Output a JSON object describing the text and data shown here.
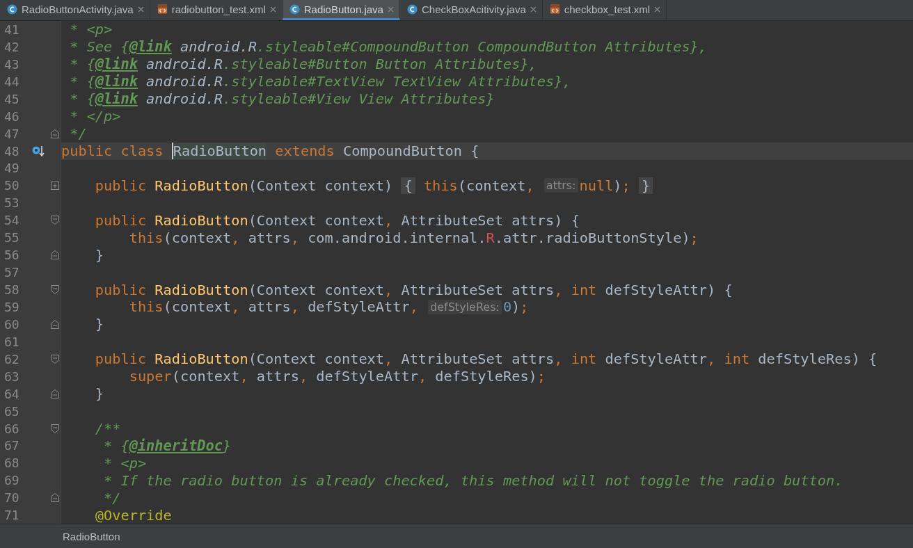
{
  "tabs": [
    {
      "label": "RadioButtonActivity.java",
      "kind": "java",
      "selected": false
    },
    {
      "label": "radiobutton_test.xml",
      "kind": "xml",
      "selected": false
    },
    {
      "label": "RadioButton.java",
      "kind": "java",
      "selected": true
    },
    {
      "label": "CheckBoxAcitivity.java",
      "kind": "java",
      "selected": false
    },
    {
      "label": "checkbox_test.xml",
      "kind": "xml",
      "selected": false
    }
  ],
  "lines": [
    {
      "number": "41",
      "tokens": [
        {
          "kind": "comment",
          "t": " * <p>"
        }
      ]
    },
    {
      "number": "42",
      "tokens": [
        {
          "kind": "comment",
          "t": " * See {"
        },
        {
          "kind": "doctag",
          "t": "@link"
        },
        {
          "kind": "docref",
          "t": " android.R"
        },
        {
          "kind": "comment",
          "t": ".styleable#CompoundButton CompoundButton Attributes},"
        }
      ]
    },
    {
      "number": "43",
      "tokens": [
        {
          "kind": "comment",
          "t": " * {"
        },
        {
          "kind": "doctag",
          "t": "@link"
        },
        {
          "kind": "docref",
          "t": " android.R"
        },
        {
          "kind": "comment",
          "t": ".styleable#Button Button Attributes},"
        }
      ]
    },
    {
      "number": "44",
      "tokens": [
        {
          "kind": "comment",
          "t": " * {"
        },
        {
          "kind": "doctag",
          "t": "@link"
        },
        {
          "kind": "docref",
          "t": " android.R"
        },
        {
          "kind": "comment",
          "t": ".styleable#TextView TextView Attributes},"
        }
      ]
    },
    {
      "number": "45",
      "tokens": [
        {
          "kind": "comment",
          "t": " * {"
        },
        {
          "kind": "doctag",
          "t": "@link"
        },
        {
          "kind": "docref",
          "t": " android.R"
        },
        {
          "kind": "comment",
          "t": ".styleable#View View Attributes}"
        }
      ]
    },
    {
      "number": "46",
      "tokens": [
        {
          "kind": "comment",
          "t": " * </p>"
        }
      ]
    },
    {
      "number": "47",
      "fold": {
        "kind": "end"
      },
      "tokens": [
        {
          "kind": "comment",
          "t": " */"
        }
      ]
    },
    {
      "number": "48",
      "current": true,
      "gutter_icon": true,
      "tokens": [
        {
          "kind": "kw",
          "t": "public class "
        },
        {
          "kind": "usage",
          "t": "RadioButton"
        },
        {
          "kind": "kw",
          "t": " extends "
        },
        {
          "kind": "plain",
          "t": "CompoundButton {"
        }
      ]
    },
    {
      "number": "49"
    },
    {
      "number": "50",
      "fold": {
        "kind": "collapsed"
      },
      "tokens": [
        {
          "kind": "kw",
          "t": "    public "
        },
        {
          "kind": "fn",
          "t": "RadioButton"
        },
        {
          "kind": "plain",
          "t": "(Context context) "
        },
        {
          "kind": "folded",
          "t": "{"
        },
        {
          "kind": "kw",
          "t": " this"
        },
        {
          "kind": "plain",
          "t": "(context"
        },
        {
          "kind": "kw",
          "t": ", "
        },
        {
          "kind": "hint",
          "t": "attrs:"
        },
        {
          "kind": "kw",
          "t": "null"
        },
        {
          "kind": "plain",
          "t": ")"
        },
        {
          "kind": "kw",
          "t": "; "
        },
        {
          "kind": "folded",
          "t": "}"
        }
      ]
    },
    {
      "number": "53"
    },
    {
      "number": "54",
      "fold": {
        "kind": "start"
      },
      "tokens": [
        {
          "kind": "kw",
          "t": "    public "
        },
        {
          "kind": "fn",
          "t": "RadioButton"
        },
        {
          "kind": "plain",
          "t": "(Context context"
        },
        {
          "kind": "kw",
          "t": ", "
        },
        {
          "kind": "plain",
          "t": "AttributeSet attrs) {"
        }
      ]
    },
    {
      "number": "55",
      "tokens": [
        {
          "kind": "kw",
          "t": "        this"
        },
        {
          "kind": "plain",
          "t": "(context"
        },
        {
          "kind": "kw",
          "t": ", "
        },
        {
          "kind": "plain",
          "t": "attrs"
        },
        {
          "kind": "kw",
          "t": ", "
        },
        {
          "kind": "plain",
          "t": "com.android.internal."
        },
        {
          "kind": "rclass",
          "t": "R"
        },
        {
          "kind": "plain",
          "t": ".attr.radioButtonStyle)"
        },
        {
          "kind": "kw",
          "t": ";"
        }
      ]
    },
    {
      "number": "56",
      "fold": {
        "kind": "end"
      },
      "tokens": [
        {
          "kind": "plain",
          "t": "    }"
        }
      ]
    },
    {
      "number": "57"
    },
    {
      "number": "58",
      "fold": {
        "kind": "start"
      },
      "tokens": [
        {
          "kind": "kw",
          "t": "    public "
        },
        {
          "kind": "fn",
          "t": "RadioButton"
        },
        {
          "kind": "plain",
          "t": "(Context context"
        },
        {
          "kind": "kw",
          "t": ", "
        },
        {
          "kind": "plain",
          "t": "AttributeSet attrs"
        },
        {
          "kind": "kw",
          "t": ", int "
        },
        {
          "kind": "plain",
          "t": "defStyleAttr) {"
        }
      ]
    },
    {
      "number": "59",
      "tokens": [
        {
          "kind": "kw",
          "t": "        this"
        },
        {
          "kind": "plain",
          "t": "(context"
        },
        {
          "kind": "kw",
          "t": ", "
        },
        {
          "kind": "plain",
          "t": "attrs"
        },
        {
          "kind": "kw",
          "t": ", "
        },
        {
          "kind": "plain",
          "t": "defStyleAttr"
        },
        {
          "kind": "kw",
          "t": ", "
        },
        {
          "kind": "hint",
          "t": "defStyleRes:"
        },
        {
          "kind": "num",
          "t": "0"
        },
        {
          "kind": "plain",
          "t": ")"
        },
        {
          "kind": "kw",
          "t": ";"
        }
      ]
    },
    {
      "number": "60",
      "fold": {
        "kind": "end"
      },
      "tokens": [
        {
          "kind": "plain",
          "t": "    }"
        }
      ]
    },
    {
      "number": "61"
    },
    {
      "number": "62",
      "fold": {
        "kind": "start"
      },
      "tokens": [
        {
          "kind": "kw",
          "t": "    public "
        },
        {
          "kind": "fn",
          "t": "RadioButton"
        },
        {
          "kind": "plain",
          "t": "(Context context"
        },
        {
          "kind": "kw",
          "t": ", "
        },
        {
          "kind": "plain",
          "t": "AttributeSet attrs"
        },
        {
          "kind": "kw",
          "t": ", int "
        },
        {
          "kind": "plain",
          "t": "defStyleAttr"
        },
        {
          "kind": "kw",
          "t": ", int "
        },
        {
          "kind": "plain",
          "t": "defStyleRes) {"
        }
      ]
    },
    {
      "number": "63",
      "tokens": [
        {
          "kind": "kw",
          "t": "        super"
        },
        {
          "kind": "plain",
          "t": "(context"
        },
        {
          "kind": "kw",
          "t": ", "
        },
        {
          "kind": "plain",
          "t": "attrs"
        },
        {
          "kind": "kw",
          "t": ", "
        },
        {
          "kind": "plain",
          "t": "defStyleAttr"
        },
        {
          "kind": "kw",
          "t": ", "
        },
        {
          "kind": "plain",
          "t": "defStyleRes)"
        },
        {
          "kind": "kw",
          "t": ";"
        }
      ]
    },
    {
      "number": "64",
      "fold": {
        "kind": "end"
      },
      "tokens": [
        {
          "kind": "plain",
          "t": "    }"
        }
      ]
    },
    {
      "number": "65"
    },
    {
      "number": "66",
      "fold": {
        "kind": "start"
      },
      "tokens": [
        {
          "kind": "comment",
          "t": "    /**"
        }
      ]
    },
    {
      "number": "67",
      "tokens": [
        {
          "kind": "comment",
          "t": "     * {"
        },
        {
          "kind": "doctag",
          "t": "@inheritDoc"
        },
        {
          "kind": "comment",
          "t": "}"
        }
      ]
    },
    {
      "number": "68",
      "tokens": [
        {
          "kind": "comment",
          "t": "     * <p>"
        }
      ]
    },
    {
      "number": "69",
      "tokens": [
        {
          "kind": "comment",
          "t": "     * If the radio button is already checked, this method will not toggle the radio button."
        }
      ]
    },
    {
      "number": "70",
      "fold": {
        "kind": "end"
      },
      "tokens": [
        {
          "kind": "comment",
          "t": "     */"
        }
      ]
    },
    {
      "number": "71",
      "tokens": [
        {
          "kind": "annot",
          "t": "    @Override"
        }
      ]
    }
  ],
  "status_bar": {
    "breadcrumb": "RadioButton"
  }
}
